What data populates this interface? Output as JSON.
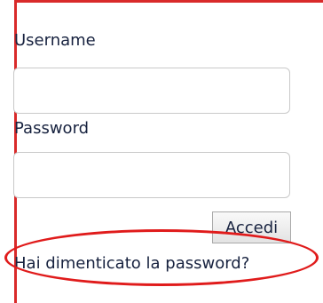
{
  "login": {
    "username_label": "Username",
    "username_value": "",
    "password_label": "Password",
    "password_value": "",
    "submit_label": "Accedi",
    "forgot_link": "Hai dimenticato la password?"
  },
  "colors": {
    "panel_border": "#d92a2a",
    "highlight_ellipse": "#e01b1b",
    "text": "#17223f"
  }
}
